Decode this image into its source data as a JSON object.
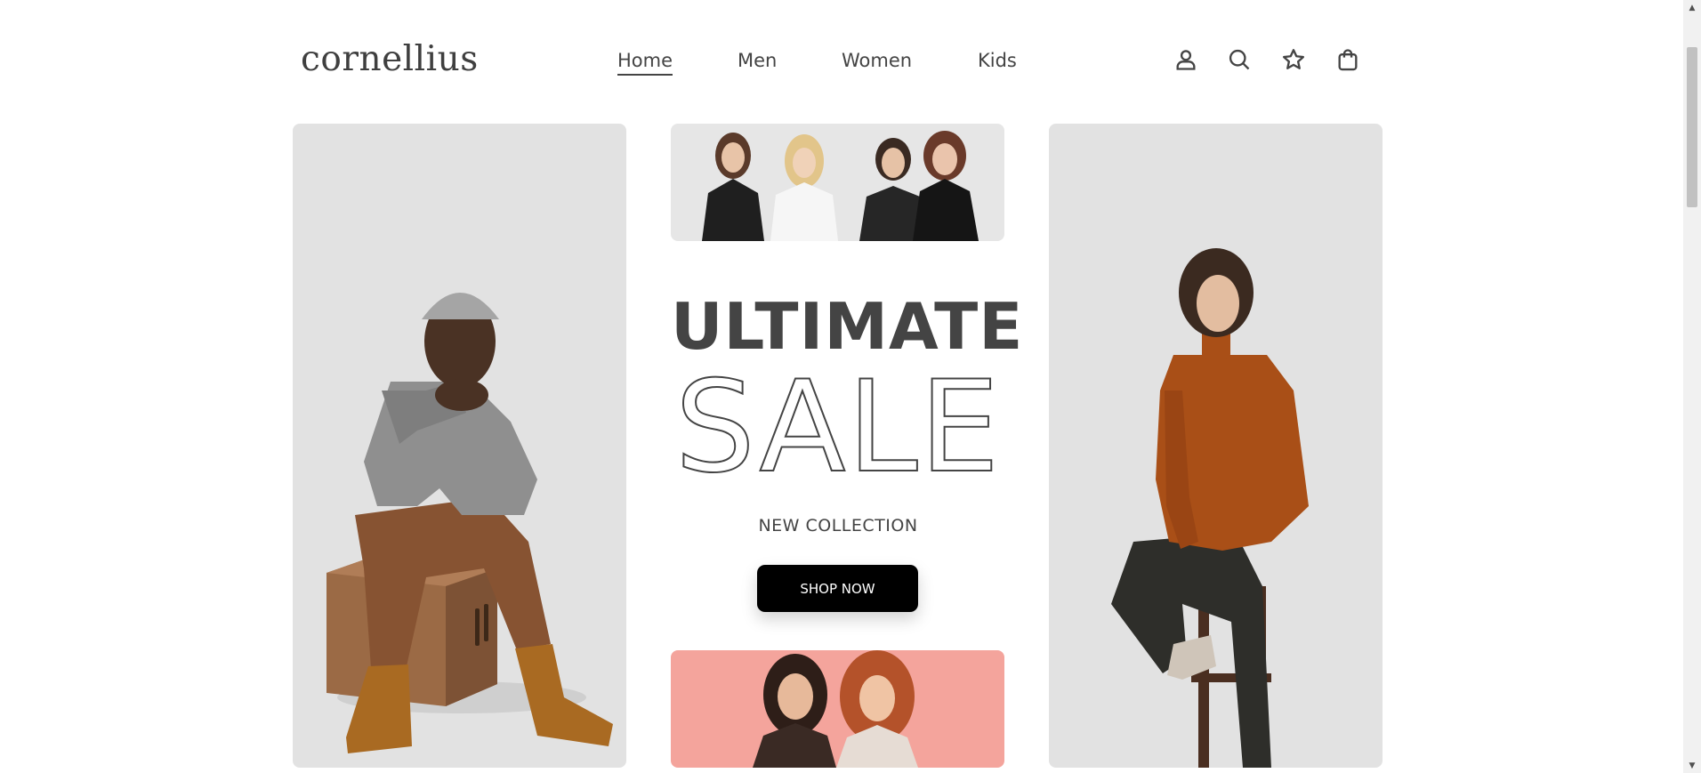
{
  "brand": {
    "logo": "cornellius"
  },
  "nav": [
    {
      "label": "Home",
      "active": true
    },
    {
      "label": "Men",
      "active": false
    },
    {
      "label": "Women",
      "active": false
    },
    {
      "label": "Kids",
      "active": false
    }
  ],
  "header_icons": [
    "user-icon",
    "search-icon",
    "star-icon",
    "shopping-bag-icon"
  ],
  "promo": {
    "title": "ULTIMATE",
    "highlight": "SALE",
    "subtitle": "NEW COLLECTION",
    "button": "SHOP NOW"
  },
  "colors": {
    "text": "#444444",
    "panel_bg": "#e2e2e2",
    "button_bg": "#000000",
    "button_text": "#ffffff",
    "accent_coral": "#f4a49c",
    "sweater_rust": "#a94f17"
  }
}
